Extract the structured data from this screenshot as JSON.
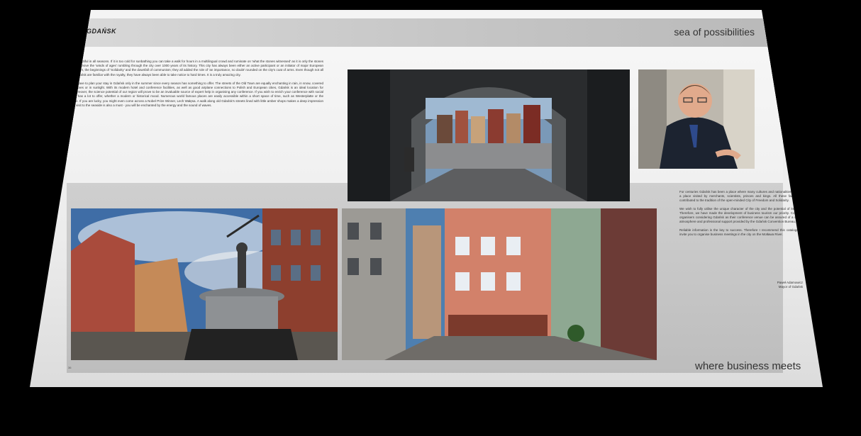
{
  "header": {
    "left_title": "GDAŃSK",
    "right_title": "sea of possibilities"
  },
  "intro_paragraphs": [
    "Gdańsk is beautiful in all seasons. If it is too cold for sunbathing you can take a walk for hours in a multilingual crowd and ruminate on 'what the stones witnessed' as it is only the stones that managed to survive the 'winds of ages' rumbling through the city over 1000 years of its history. This city has always been either an active participant or an initiator of major European events: World War II, the beginnings of 'Solidarity' and the downfall of communism; they all added the role of 'an importance, no doubt' rounded on the city's coat of arms. Even though not all the old sites of Gdańsk are familiar with the royalty, they have always been able to take notice to hard times. It is a truly amazing city.",
    "You do not have to plan your stay in Gdańsk only in the summer since every season has something to offer. The streets of the Old Town are equally enchanting in rain, in snow, covered with colourful leaves or in sunlight. With its modern hotel and conference facilities, as well as good airplane connections to Polish and European cities, Gdańsk is an ideal location for conferences. Moreover, the science potential of our region will prove to be an invaluable source of expert help in organising any conference. If you wish to enrich your conference with social events, Gdańsk has a lot to offer, whether a modern or historical mood. Numerous world famous places are easily accessible within a short space of time, such as Westerplatte or the Solidarity Centre. If you are lucky, you might even come across a Nobel Prize Winner, Lech Wałęsa. A walk along old Gdańsk's streets lined with little amber shops makes a deep impression on everyone. A visit to the seaside is also a must - you will be enchanted by the energy and the sound of waves."
  ],
  "mayor_paragraphs": [
    "For centuries Gdańsk has been a place where many cultures and nationalities coexisted, a place visited by merchants, scientists, princes and kings. All these factors have contributed to the tradition of the open-minded City of Freedom and Solidarity.",
    "We wish to fully utilise the unique character of the city and the potential of its citizens. Therefore, we have made the development of business tourism our priority. Conference organisers considering Gdańsk as their conference venue can be assured of a welcome atmosphere and professional support provided by the Gdańsk Convention Bureau.",
    "Reliable information is the key to success. Therefore I recommend this catalogue and invite you to organise business meetings in the city on the Motława River."
  ],
  "signature": {
    "name": "Paweł Adamowicz",
    "title": "Mayor of Gdańsk"
  },
  "tagline": "where business meets",
  "page_numbers": {
    "left": "36",
    "right": "37"
  }
}
